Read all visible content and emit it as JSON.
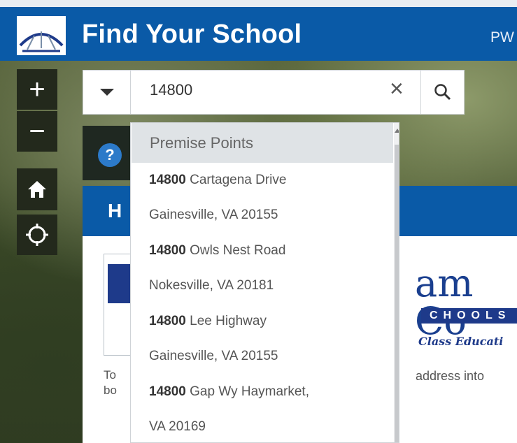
{
  "header": {
    "title": "Find Your School",
    "right_text": "PW"
  },
  "map_controls": {
    "zoom_in": "+",
    "zoom_out": "−",
    "home_icon": "home-icon",
    "locate_icon": "locate-icon"
  },
  "search": {
    "value": "14800",
    "clear_glyph": "×",
    "icons": {
      "menu": "chevron-down-icon",
      "search": "search-icon"
    }
  },
  "help": {
    "glyph": "?"
  },
  "panel": {
    "title": "H",
    "brand_name": "am Co",
    "brand_schools": "CHOOLS",
    "brand_tagline": "Class Educati",
    "text_left_1": "To",
    "text_left_2": "bo",
    "text_right": "address into"
  },
  "dropdown": {
    "group_header": "Premise Points",
    "results": [
      {
        "match": "14800",
        "rest": " Cartagena Drive",
        "line2": "Gainesville, VA 20155"
      },
      {
        "match": "14800",
        "rest": " Owls Nest Road",
        "line2": "Nokesville, VA 20181"
      },
      {
        "match": "14800",
        "rest": " Lee Highway",
        "line2": "Gainesville, VA 20155"
      },
      {
        "match": "14800",
        "rest": " Gap Wy Haymarket,",
        "line2": "VA 20169"
      }
    ]
  },
  "colors": {
    "header_blue": "#0a5aa7",
    "dropdown_header_bg": "#dfe3e6"
  }
}
